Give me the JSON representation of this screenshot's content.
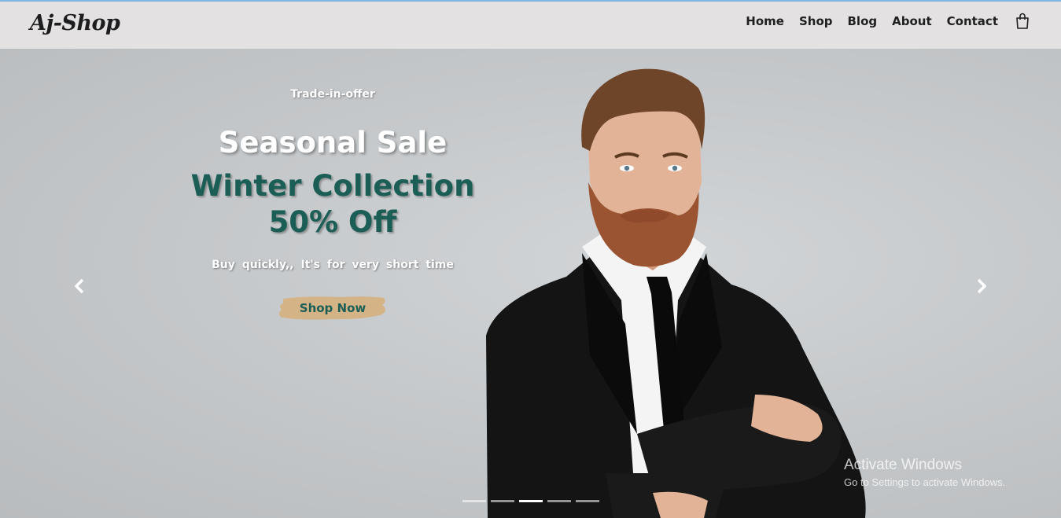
{
  "brand": {
    "logo_text": "Aj-Shop"
  },
  "nav": {
    "items": [
      {
        "label": "Home"
      },
      {
        "label": "Shop"
      },
      {
        "label": "Blog"
      },
      {
        "label": "About"
      },
      {
        "label": "Contact"
      }
    ],
    "cart_icon": "shopping-bag-icon"
  },
  "hero": {
    "eyebrow": "Trade-in-offer",
    "headline": "Seasonal Sale",
    "collection_line1": "Winter Collection",
    "collection_line2": "50% Off",
    "tagline": "Buy quickly,, It's for very short time",
    "cta_label": "Shop Now",
    "prev_icon": "chevron-left-icon",
    "next_icon": "chevron-right-icon",
    "image": "man-in-suit-with-crossed-arms",
    "slides": {
      "count": 5,
      "active_index": 2
    }
  },
  "watermark": {
    "title": "Activate Windows",
    "subtitle": "Go to Settings to activate Windows."
  },
  "colors": {
    "navbar_bg": "#e3e1e2",
    "hero_bg": "#c3c6c8",
    "accent_green": "#1b5e56",
    "cta_brush": "#d4b386"
  }
}
